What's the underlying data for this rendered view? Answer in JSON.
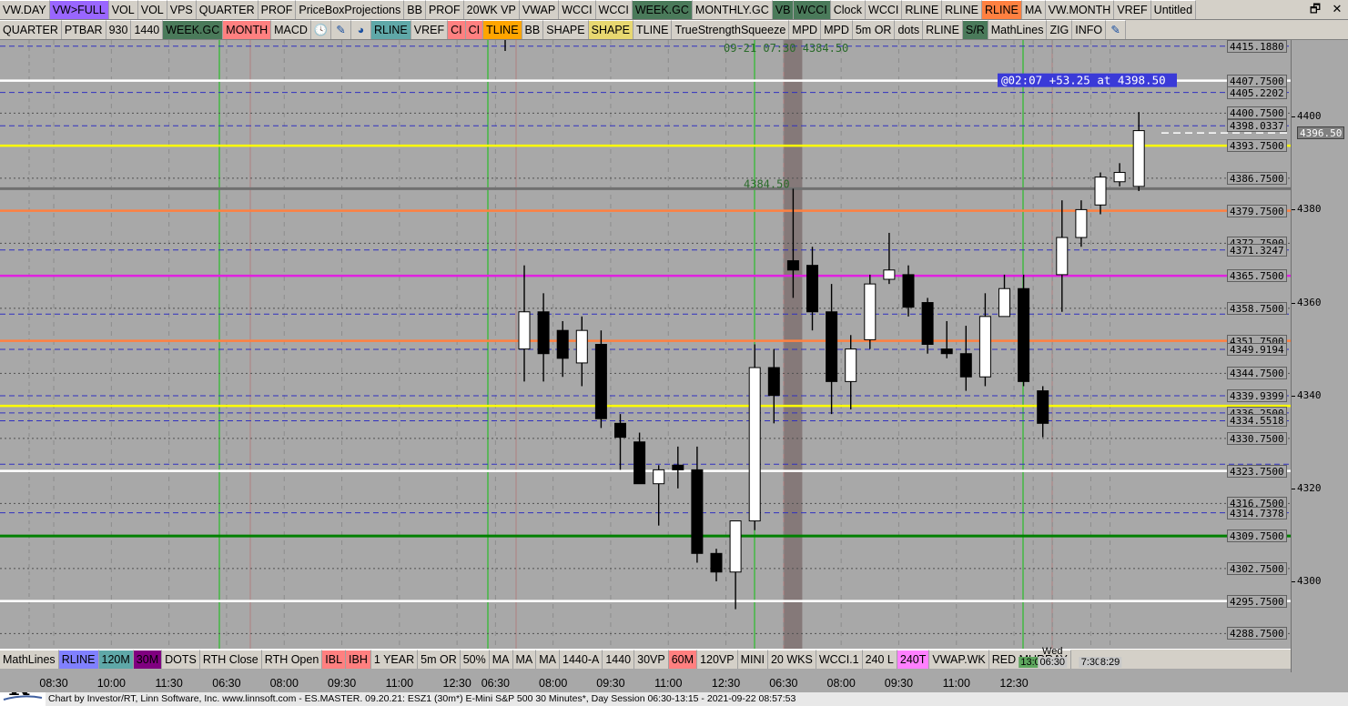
{
  "toolbar_top": [
    {
      "label": "VW.DAY",
      "bg": "#d4d0c8"
    },
    {
      "label": "VW>FULL",
      "bg": "#9966ff"
    },
    {
      "label": "VOL",
      "bg": "#d4d0c8"
    },
    {
      "label": "VOL",
      "bg": "#d4d0c8"
    },
    {
      "label": "VPS",
      "bg": "#d4d0c8"
    },
    {
      "label": "QUARTER",
      "bg": "#d4d0c8"
    },
    {
      "label": "PROF",
      "bg": "#d4d0c8"
    },
    {
      "label": "PriceBoxProjections",
      "bg": "#d4d0c8"
    },
    {
      "label": "BB",
      "bg": "#d4d0c8"
    },
    {
      "label": "PROF",
      "bg": "#d4d0c8"
    },
    {
      "label": "20WK VP",
      "bg": "#d4d0c8"
    },
    {
      "label": "VWAP",
      "bg": "#d4d0c8"
    },
    {
      "label": "WCCI",
      "bg": "#d4d0c8"
    },
    {
      "label": "WCCI",
      "bg": "#d4d0c8"
    },
    {
      "label": "WEEK.GC",
      "bg": "#4a7a5a"
    },
    {
      "label": "MONTHLY.GC",
      "bg": "#d4d0c8"
    },
    {
      "label": "VB",
      "bg": "#4a7a5a"
    },
    {
      "label": "WCCI",
      "bg": "#4a7a5a"
    },
    {
      "label": "Clock",
      "bg": "#d4d0c8"
    },
    {
      "label": "WCCI",
      "bg": "#d4d0c8"
    },
    {
      "label": "RLINE",
      "bg": "#d4d0c8"
    },
    {
      "label": "RLINE",
      "bg": "#d4d0c8"
    },
    {
      "label": "RLINE",
      "bg": "#ff8040"
    },
    {
      "label": "MA",
      "bg": "#d4d0c8"
    },
    {
      "label": "VW.MONTH",
      "bg": "#d4d0c8"
    },
    {
      "label": "VREF",
      "bg": "#d4d0c8"
    },
    {
      "label": "Untitled",
      "bg": "#d4d0c8"
    }
  ],
  "toolbar_second": [
    {
      "label": "QUARTER",
      "bg": "#d4d0c8"
    },
    {
      "label": "PTBAR",
      "bg": "#d4d0c8"
    },
    {
      "label": "930",
      "bg": "#d4d0c8"
    },
    {
      "label": "1440",
      "bg": "#d4d0c8"
    },
    {
      "label": "WEEK.GC",
      "bg": "#4a7a5a"
    },
    {
      "label": "MONTH",
      "bg": "#ff8080"
    },
    {
      "label": "MACD",
      "bg": "#d4d0c8"
    },
    {
      "icon": "clock-icon",
      "glyph": "🕓"
    },
    {
      "icon": "pencil-icon",
      "glyph": "✎"
    },
    {
      "icon": "refresh-icon",
      "glyph": "◕"
    },
    {
      "label": "RLINE",
      "bg": "#5fa8a8"
    },
    {
      "label": "VREF",
      "bg": "#d4d0c8"
    },
    {
      "label": "CI",
      "bg": "#ff8080"
    },
    {
      "label": "CI",
      "bg": "#ff8080"
    },
    {
      "label": "TLINE",
      "bg": "#ffa500"
    },
    {
      "label": "BB",
      "bg": "#d4d0c8"
    },
    {
      "label": "SHAPE",
      "bg": "#d4d0c8"
    },
    {
      "label": "SHAPE",
      "bg": "#e8d870"
    },
    {
      "label": "TLINE",
      "bg": "#d4d0c8"
    },
    {
      "label": "TrueStrengthSqueeze",
      "bg": "#d4d0c8"
    },
    {
      "label": "MPD",
      "bg": "#d4d0c8"
    },
    {
      "label": "MPD",
      "bg": "#d4d0c8"
    },
    {
      "label": "5m OR",
      "bg": "#d4d0c8"
    },
    {
      "label": "dots",
      "bg": "#d4d0c8"
    },
    {
      "label": "RLINE",
      "bg": "#d4d0c8"
    },
    {
      "label": "S/R",
      "bg": "#4a7a5a"
    },
    {
      "label": "MathLines",
      "bg": "#d4d0c8"
    },
    {
      "label": "ZIG",
      "bg": "#d4d0c8"
    },
    {
      "label": "INFO",
      "bg": "#d4d0c8"
    },
    {
      "icon": "pencil-icon",
      "glyph": "✎"
    }
  ],
  "toolbar_bottom": [
    {
      "label": "MathLines",
      "bg": "#d4d0c8"
    },
    {
      "label": "RLINE",
      "bg": "#8080ff"
    },
    {
      "label": "120M",
      "bg": "#5fa8a8"
    },
    {
      "label": "30M",
      "bg": "#800080"
    },
    {
      "label": "DOTS",
      "bg": "#d4d0c8"
    },
    {
      "label": "RTH Close",
      "bg": "#d4d0c8"
    },
    {
      "label": "RTH Open",
      "bg": "#d4d0c8"
    },
    {
      "label": "IBL",
      "bg": "#ff8080"
    },
    {
      "label": "IBH",
      "bg": "#ff8080"
    },
    {
      "label": "1 YEAR",
      "bg": "#d4d0c8"
    },
    {
      "label": "5m OR",
      "bg": "#d4d0c8"
    },
    {
      "label": "50%",
      "bg": "#d4d0c8"
    },
    {
      "label": "MA",
      "bg": "#d4d0c8"
    },
    {
      "label": "MA",
      "bg": "#d4d0c8"
    },
    {
      "label": "MA",
      "bg": "#d4d0c8"
    },
    {
      "label": "1440-A",
      "bg": "#d4d0c8"
    },
    {
      "label": "1440",
      "bg": "#d4d0c8"
    },
    {
      "label": "30VP",
      "bg": "#d4d0c8"
    },
    {
      "label": "60M",
      "bg": "#ff8080"
    },
    {
      "label": "120VP",
      "bg": "#d4d0c8"
    },
    {
      "label": "MINI",
      "bg": "#d4d0c8"
    },
    {
      "label": "20 WKS",
      "bg": "#d4d0c8"
    },
    {
      "label": "WCCI.1",
      "bg": "#d4d0c8"
    },
    {
      "label": "240 L",
      "bg": "#d4d0c8"
    },
    {
      "label": "240T",
      "bg": "#ff80ff"
    },
    {
      "label": "VWAP.WK",
      "bg": "#d4d0c8"
    },
    {
      "label": "RED MURRAY",
      "bg": "#d4d0c8"
    }
  ],
  "status_bar": "Chart by Investor/RT, Linn Software, Inc. www.linnsoft.com - ES.MASTER.    09.20.21: ESZ1 (30m*) E-Mini S&P 500 30 Minutes*, Day Session 06:30-13:15 - 2021-09-22 08:57:53",
  "window_controls": {
    "restore": "🗗",
    "close": "✕"
  },
  "chart_data": {
    "type": "candlestick",
    "ylim": [
      4285.5,
      4416.5
    ],
    "y_ticks": [
      4300,
      4320,
      4340,
      4360,
      4380,
      4400
    ],
    "current_price": "4396.50",
    "annotations": [
      {
        "text": "09-21 07:30  4384.50",
        "kind": "header-note"
      },
      {
        "text": "4384.50",
        "kind": "price-note"
      },
      {
        "text": "@02:07  +53.25 at 4398.50",
        "kind": "info-box"
      }
    ],
    "time_labels": [
      {
        "label": "08:30",
        "bar": -24.5
      },
      {
        "label": "10:00",
        "bar": -21.5
      },
      {
        "label": "11:30",
        "bar": -18.5
      },
      {
        "label": "06:30",
        "bar": -15.5
      },
      {
        "label": "08:00",
        "bar": -12.5
      },
      {
        "label": "09:30",
        "bar": -9.5
      },
      {
        "label": "11:00",
        "bar": -6.5
      },
      {
        "label": "12:30",
        "bar": -3.5
      },
      {
        "label": "06:30",
        "bar": -1.5
      },
      {
        "label": "08:00",
        "bar": 1.5
      },
      {
        "label": "09:30",
        "bar": 4.5
      },
      {
        "label": "11:00",
        "bar": 7.5
      },
      {
        "label": "12:30",
        "bar": 10.5
      },
      {
        "label": "06:30",
        "bar": 13.5
      },
      {
        "label": "08:00",
        "bar": 16.5
      },
      {
        "label": "09:30",
        "bar": 19.5
      },
      {
        "label": "11:00",
        "bar": 22.5
      },
      {
        "label": "12:30",
        "bar": 25.5
      },
      {
        "label": "13:00",
        "bar": 26.5
      },
      {
        "label": "06:30",
        "bar": 27.5
      },
      {
        "label": "7:30",
        "bar": 29.5
      },
      {
        "label": "8:29",
        "bar": 30.5
      }
    ],
    "day_label": "Wed",
    "candles": [
      {
        "o": 4350,
        "h": 4368,
        "l": 4343,
        "c": 4358
      },
      {
        "o": 4358,
        "h": 4362,
        "l": 4343,
        "c": 4349
      },
      {
        "o": 4354,
        "h": 4356,
        "l": 4344,
        "c": 4348
      },
      {
        "o": 4347,
        "h": 4357,
        "l": 4342,
        "c": 4354
      },
      {
        "o": 4351,
        "h": 4354,
        "l": 4333,
        "c": 4335
      },
      {
        "o": 4334,
        "h": 4336,
        "l": 4324,
        "c": 4331
      },
      {
        "o": 4330,
        "h": 4332,
        "l": 4323,
        "c": 4321
      },
      {
        "o": 4321,
        "h": 4325,
        "l": 4312,
        "c": 4324
      },
      {
        "o": 4325,
        "h": 4329,
        "l": 4320,
        "c": 4324
      },
      {
        "o": 4324,
        "h": 4329,
        "l": 4304,
        "c": 4306
      },
      {
        "o": 4306,
        "h": 4307,
        "l": 4300,
        "c": 4302
      },
      {
        "o": 4302,
        "h": 4313,
        "l": 4294,
        "c": 4313
      },
      {
        "o": 4313,
        "h": 4351,
        "l": 4311,
        "c": 4346
      },
      {
        "o": 4346,
        "h": 4350,
        "l": 4334,
        "c": 4340
      },
      {
        "o": 4369,
        "h": 4384.5,
        "l": 4361,
        "c": 4367
      },
      {
        "o": 4368,
        "h": 4372,
        "l": 4354,
        "c": 4358
      },
      {
        "o": 4358,
        "h": 4364,
        "l": 4336,
        "c": 4343
      },
      {
        "o": 4343,
        "h": 4353,
        "l": 4337,
        "c": 4350
      },
      {
        "o": 4352,
        "h": 4366,
        "l": 4350,
        "c": 4364
      },
      {
        "o": 4365,
        "h": 4375,
        "l": 4364,
        "c": 4367
      },
      {
        "o": 4366,
        "h": 4368,
        "l": 4357,
        "c": 4359
      },
      {
        "o": 4360,
        "h": 4361,
        "l": 4349,
        "c": 4351
      },
      {
        "o": 4350,
        "h": 4356,
        "l": 4348,
        "c": 4349
      },
      {
        "o": 4349,
        "h": 4355,
        "l": 4341,
        "c": 4344
      },
      {
        "o": 4344,
        "h": 4362,
        "l": 4342,
        "c": 4357
      },
      {
        "o": 4357,
        "h": 4366,
        "l": 4357,
        "c": 4363
      },
      {
        "o": 4363,
        "h": 4366,
        "l": 4342,
        "c": 4343
      },
      {
        "o": 4341,
        "h": 4342,
        "l": 4331,
        "c": 4334
      },
      {
        "o": 4366,
        "h": 4382,
        "l": 4358,
        "c": 4374
      },
      {
        "o": 4374,
        "h": 4382,
        "l": 4372,
        "c": 4380
      },
      {
        "o": 4381,
        "h": 4388,
        "l": 4379,
        "c": 4387
      },
      {
        "o": 4386,
        "h": 4390,
        "l": 4385,
        "c": 4388
      },
      {
        "o": 4385,
        "h": 4401,
        "l": 4384,
        "c": 4397
      }
    ],
    "levels": [
      {
        "price": 4415.188,
        "label": "4415.1880",
        "color": "#3030c0",
        "style": "dash",
        "width": 1
      },
      {
        "price": 4407.75,
        "label": "4407.7500",
        "color": "#ffffff",
        "style": "solid",
        "width": 2.5
      },
      {
        "price": 4405.2202,
        "label": "4405.2202",
        "color": "#3030c0",
        "style": "dash",
        "width": 1
      },
      {
        "price": 4400.75,
        "label": "4400.7500",
        "color": "#505050",
        "style": "dot",
        "width": 1
      },
      {
        "price": 4398.0337,
        "label": "4398.0337",
        "color": "#3030c0",
        "style": "dash",
        "width": 1
      },
      {
        "price": 4393.75,
        "label": "4393.7500",
        "color": "#ffff00",
        "style": "solid",
        "width": 2.5
      },
      {
        "price": 4386.75,
        "label": "4386.7500",
        "color": "#505050",
        "style": "dot",
        "width": 1
      },
      {
        "price": 4384.5,
        "label": "",
        "color": "#707070",
        "style": "solid",
        "width": 3
      },
      {
        "price": 4379.75,
        "label": "4379.7500",
        "color": "#ff8040",
        "style": "solid",
        "width": 2.5
      },
      {
        "price": 4372.75,
        "label": "4372.7500",
        "color": "#505050",
        "style": "dot",
        "width": 1
      },
      {
        "price": 4371.3247,
        "label": "4371.3247",
        "color": "#3030c0",
        "style": "dash",
        "width": 1
      },
      {
        "price": 4365.75,
        "label": "4365.7500",
        "color": "#e020e0",
        "style": "solid",
        "width": 2.5
      },
      {
        "price": 4358.75,
        "label": "4358.7500",
        "color": "#505050",
        "style": "dot",
        "width": 1
      },
      {
        "price": 4357.5,
        "label": "",
        "color": "#3030c0",
        "style": "dash",
        "width": 1
      },
      {
        "price": 4351.75,
        "label": "4351.7500",
        "color": "#ff8040",
        "style": "solid",
        "width": 2.5
      },
      {
        "price": 4349.9194,
        "label": "4349.9194",
        "color": "#3030c0",
        "style": "dash",
        "width": 1
      },
      {
        "price": 4344.75,
        "label": "4344.7500",
        "color": "#505050",
        "style": "dot",
        "width": 1
      },
      {
        "price": 4339.9399,
        "label": "4339.9399",
        "color": "#3030c0",
        "style": "dash",
        "width": 1
      },
      {
        "price": 4337.75,
        "label": "",
        "color": "#ffff00",
        "style": "solid",
        "width": 2.5
      },
      {
        "price": 4336.25,
        "label": "4336.2500",
        "color": "#3030c0",
        "style": "dash",
        "width": 1
      },
      {
        "price": 4334.5518,
        "label": "4334.5518",
        "color": "#3030c0",
        "style": "dash",
        "width": 1
      },
      {
        "price": 4330.75,
        "label": "4330.7500",
        "color": "#505050",
        "style": "dot",
        "width": 1
      },
      {
        "price": 4325.2,
        "label": "",
        "color": "#3030c0",
        "style": "dash",
        "width": 1
      },
      {
        "price": 4323.75,
        "label": "4323.7500",
        "color": "#ffffff",
        "style": "solid",
        "width": 2.5
      },
      {
        "price": 4316.75,
        "label": "4316.7500",
        "color": "#505050",
        "style": "dot",
        "width": 1
      },
      {
        "price": 4314.7378,
        "label": "4314.7378",
        "color": "#3030c0",
        "style": "dash",
        "width": 1
      },
      {
        "price": 4309.75,
        "label": "4309.7500",
        "color": "#008000",
        "style": "solid",
        "width": 3
      },
      {
        "price": 4302.75,
        "label": "4302.7500",
        "color": "#505050",
        "style": "dot",
        "width": 1
      },
      {
        "price": 4295.75,
        "label": "4295.7500",
        "color": "#ffffff",
        "style": "solid",
        "width": 2.5
      },
      {
        "price": 4288.75,
        "label": "4288.7500",
        "color": "#505050",
        "style": "dot",
        "width": 1
      }
    ]
  }
}
